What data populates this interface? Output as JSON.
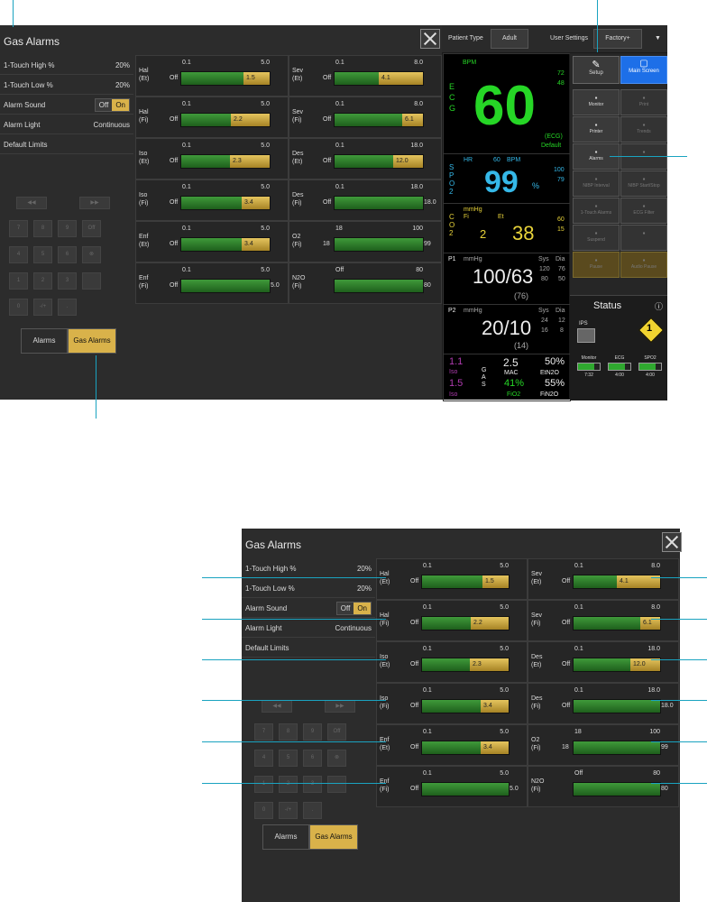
{
  "dialog": {
    "title": "Gas Alarms",
    "settings": [
      {
        "label": "1-Touch High %",
        "value": "20%"
      },
      {
        "label": "1-Touch Low %",
        "value": "20%"
      },
      {
        "label": "Alarm Sound",
        "value": ""
      },
      {
        "label": "Alarm Light",
        "value": "Continuous"
      },
      {
        "label": "Default Limits",
        "value": ""
      }
    ],
    "alarm_sound_toggle": {
      "off": "Off",
      "on": "On",
      "selected": "On"
    },
    "keypad": [
      "◀◀",
      "▶▶",
      "7",
      "8",
      "9",
      "Off",
      "4",
      "5",
      "6",
      "⊗",
      "1",
      "2",
      "3",
      "",
      "0",
      "-/+",
      "."
    ],
    "tabs": {
      "alarms": "Alarms",
      "gas_alarms": "Gas Alarms",
      "selected": "Gas Alarms"
    },
    "gases": [
      {
        "name1": "Hal",
        "name2": "(Et)",
        "low": "0.1",
        "high": "5.0",
        "off": "Off",
        "value": "1.5",
        "end": ""
      },
      {
        "name1": "Sev",
        "name2": "(Et)",
        "low": "0.1",
        "high": "8.0",
        "off": "Off",
        "value": "4.1",
        "end": ""
      },
      {
        "name1": "Hal",
        "name2": "(Fi)",
        "low": "0.1",
        "high": "5.0",
        "off": "Off",
        "value": "2.2",
        "end": ""
      },
      {
        "name1": "Sev",
        "name2": "(Fi)",
        "low": "0.1",
        "high": "8.0",
        "off": "Off",
        "value": "6.1",
        "end": ""
      },
      {
        "name1": "Iso",
        "name2": "(Et)",
        "low": "0.1",
        "high": "5.0",
        "off": "Off",
        "value": "2.3",
        "end": ""
      },
      {
        "name1": "Des",
        "name2": "(Et)",
        "low": "0.1",
        "high": "18.0",
        "off": "Off",
        "value": "12.0",
        "end": ""
      },
      {
        "name1": "Iso",
        "name2": "(Fi)",
        "low": "0.1",
        "high": "5.0",
        "off": "Off",
        "value": "3.4",
        "end": ""
      },
      {
        "name1": "Des",
        "name2": "(Fi)",
        "low": "0.1",
        "high": "18.0",
        "off": "Off",
        "value": "",
        "end": "18.0"
      },
      {
        "name1": "Enf",
        "name2": "(Et)",
        "low": "0.1",
        "high": "5.0",
        "off": "Off",
        "value": "3.4",
        "end": ""
      },
      {
        "name1": "O2",
        "name2": "(Fi)",
        "low": "18",
        "high": "100",
        "off": "18",
        "value": "",
        "end": "99"
      },
      {
        "name1": "Enf",
        "name2": "(Fi)",
        "low": "0.1",
        "high": "5.0",
        "off": "Off",
        "value": "",
        "end": "5.0"
      },
      {
        "name1": "N2O",
        "name2": "(Fi)",
        "low": "Off",
        "high": "80",
        "off": "",
        "value": "",
        "end": "80"
      }
    ],
    "yellow_fraction": [
      0.3,
      0.5,
      0.44,
      0.23,
      0.45,
      0.34,
      0.32,
      0,
      0.32,
      0,
      0,
      0
    ]
  },
  "monitor": {
    "header": {
      "patient_type_label": "Patient Type",
      "patient_type": "Adult",
      "user_settings_label": "User Settings",
      "user_settings": "Factory+"
    },
    "ecg": {
      "label": "ECG",
      "unit": "BPM",
      "value": "60",
      "hi": "72",
      "lo": "48",
      "src": "(ECG)",
      "default": "Default"
    },
    "spo2": {
      "label": "SPO2",
      "hr_label": "HR",
      "hr": "60",
      "unit": "BPM",
      "value": "99",
      "pct": "%",
      "hi": "100",
      "lo": "79"
    },
    "co2": {
      "label": "CO2",
      "unit": "mmHg",
      "fi_label": "Fi",
      "et_label": "Et",
      "fi": "2",
      "et": "38",
      "hi": "60",
      "lo": "15"
    },
    "p1": {
      "label": "P1",
      "unit": "mmHg",
      "sys_label": "Sys",
      "dia_label": "Dia",
      "value": "100/63",
      "mean": "(76)",
      "sys_hi": "120",
      "sys_lo": "80",
      "dia_hi": "76",
      "dia_lo": "50"
    },
    "p2": {
      "label": "P2",
      "unit": "mmHg",
      "sys_label": "Sys",
      "dia_label": "Dia",
      "value": "20/10",
      "mean": "(14)",
      "sys_hi": "24",
      "sys_lo": "16",
      "dia_hi": "12",
      "dia_lo": "8"
    },
    "gas": {
      "iso_top": "1.1",
      "iso_label": "Iso",
      "iso_bottom": "1.5",
      "iso_label2": "Iso",
      "gas_label": "GAS",
      "mac": "2.5",
      "mac_label": "MAC",
      "etn2o": "50%",
      "etn2o_label": "EtN2O",
      "fio2": "41%",
      "fio2_label": "FiO2",
      "fin2o": "55%",
      "fin2o_label": "FiN2O"
    },
    "side": {
      "setup": "Setup",
      "main_screen": "Main Screen",
      "buttons": [
        "Monitor",
        "Print",
        "Printer",
        "Trends",
        "Alarms",
        "",
        "NIBP Interval",
        "NIBP Start/Stop",
        "1-Touch Alarms",
        "ECG Filter",
        "Suspend",
        "",
        "Pause",
        "Audio Pause"
      ]
    },
    "status": {
      "title": "Status",
      "device": "IPS",
      "badge": "1",
      "items": [
        {
          "name": "Monitor",
          "time": "7:32"
        },
        {
          "name": "ECG",
          "time": "4:00"
        },
        {
          "name": "SPO2",
          "time": "4:00"
        }
      ]
    }
  },
  "zoom": {
    "title": "Gas Alarms"
  }
}
